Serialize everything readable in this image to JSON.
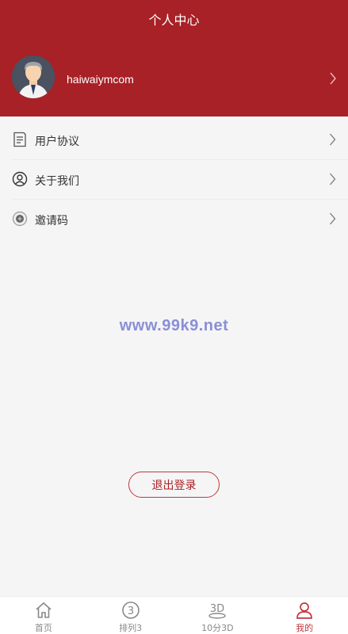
{
  "header": {
    "title": "个人中心",
    "username": "haiwaiymcom"
  },
  "menu": {
    "items": [
      {
        "label": "用户协议",
        "icon": "document-icon"
      },
      {
        "label": "关于我们",
        "icon": "user-circle-icon"
      },
      {
        "label": "邀请码",
        "icon": "invite-code-icon"
      }
    ]
  },
  "watermark": "www.99k9.net",
  "logout_label": "退出登录",
  "tabbar": {
    "items": [
      {
        "label": "首页",
        "icon": "home-icon",
        "active": false
      },
      {
        "label": "排列3",
        "icon": "circled-three-icon",
        "active": false
      },
      {
        "label": "10分3D",
        "icon": "3d-icon",
        "active": false
      },
      {
        "label": "我的",
        "icon": "user-icon",
        "active": true
      }
    ]
  },
  "colors": {
    "brand": "#a82126",
    "active_tab": "#c0383d",
    "watermark": "#8a8fd6"
  }
}
